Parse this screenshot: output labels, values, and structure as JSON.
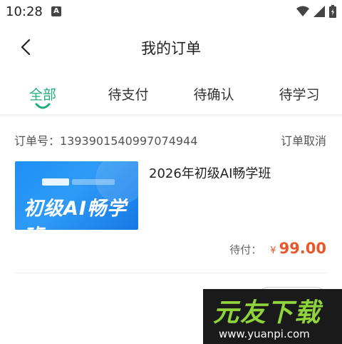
{
  "status_bar": {
    "time": "10:28",
    "notification_badge": "A"
  },
  "header": {
    "title": "我的订单"
  },
  "tabs": [
    {
      "label": "全部",
      "active": true
    },
    {
      "label": "待支付",
      "active": false
    },
    {
      "label": "待确认",
      "active": false
    },
    {
      "label": "待学习",
      "active": false
    }
  ],
  "order": {
    "number_label": "订单号：1393901540997074944",
    "cancel_label": "订单取消",
    "thumbnail_title": "初级AI畅学班",
    "course_title": "2026年初级AI畅学班",
    "pay_label": "待付：",
    "currency": "¥",
    "amount": "99.00"
  },
  "watermark": {
    "logo": "元友下载",
    "url": "www.yuanpi.com"
  },
  "colors": {
    "accent": "#1fae7a",
    "price": "#e8572a",
    "thumb_blue": "#1e8ff5"
  }
}
